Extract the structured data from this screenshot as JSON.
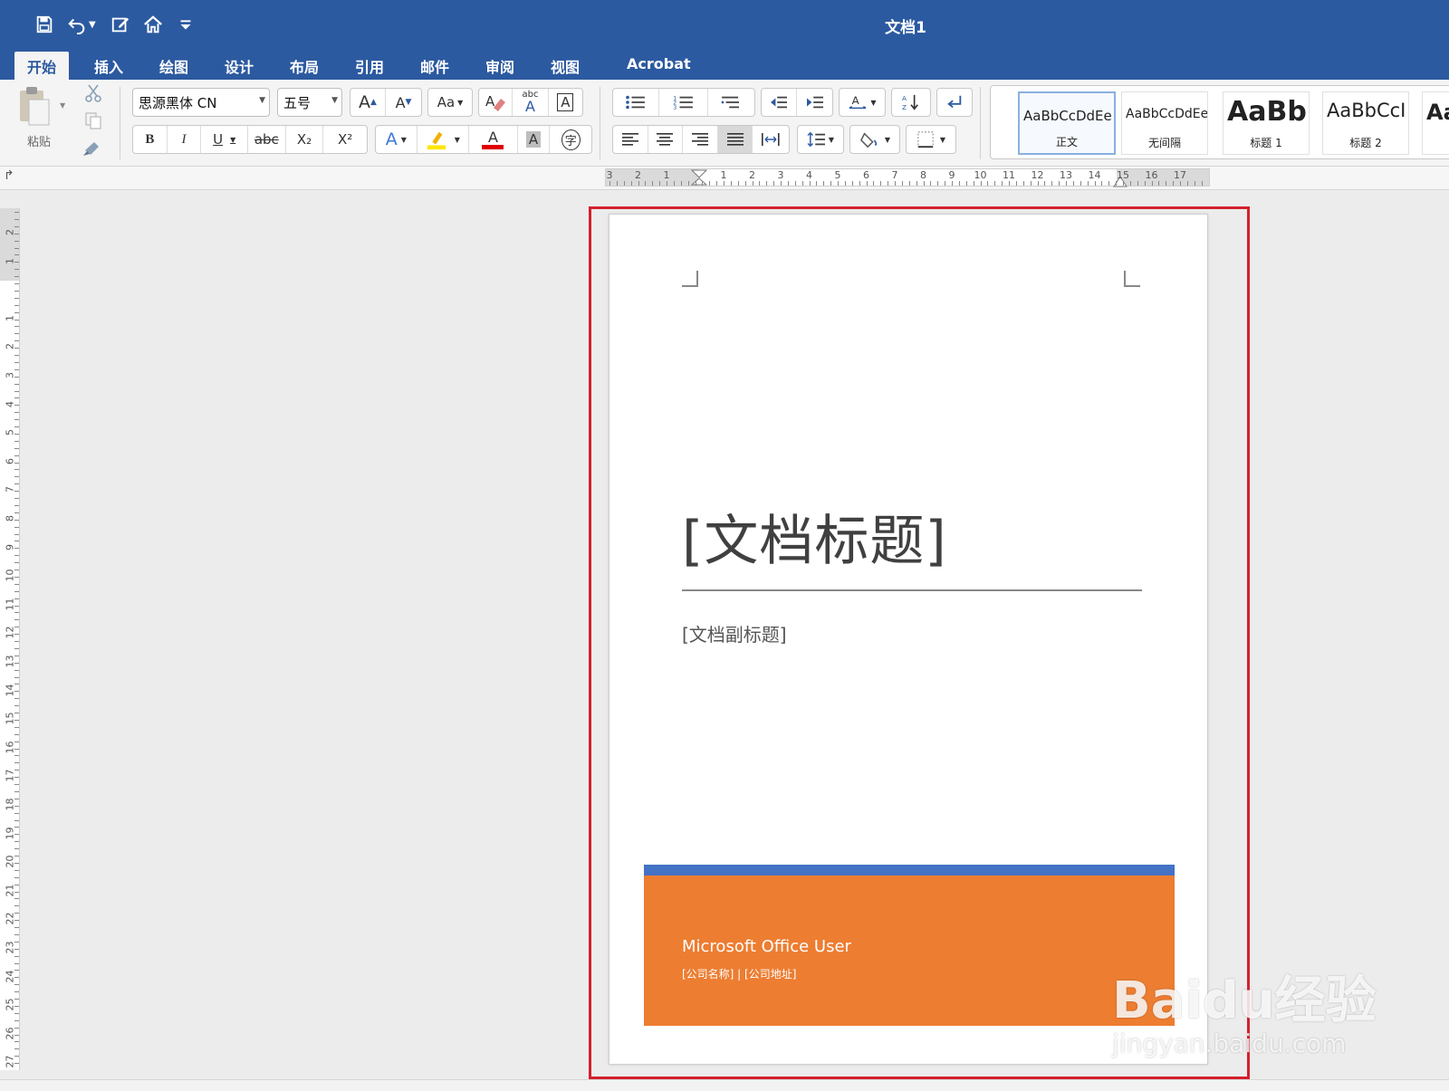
{
  "window": {
    "title": "文档1"
  },
  "tabs": [
    "开始",
    "插入",
    "绘图",
    "设计",
    "布局",
    "引用",
    "邮件",
    "审阅",
    "视图",
    "Acrobat"
  ],
  "clipboard": {
    "paste_label": "粘贴"
  },
  "font": {
    "name": "思源黑体 CN",
    "size": "五号"
  },
  "format_buttons": {
    "bold": "B",
    "italic": "I",
    "underline": "U",
    "strike": "abc",
    "subscript": "X₂",
    "superscript": "X²",
    "char_shade": "A",
    "enclose": "字",
    "grow": "A",
    "shrink": "A",
    "change_case": "Aa",
    "phonetic_top": "abc",
    "phonetic_bottom": "A",
    "char_border": "A",
    "effects": "A",
    "font_color": "A"
  },
  "styles": [
    {
      "preview": "AaBbCcDdEe",
      "name": "正文",
      "selected": true
    },
    {
      "preview": "AaBbCcDdEe",
      "name": "无间隔",
      "selected": false
    },
    {
      "preview": "AaBb(",
      "name": "标题 1",
      "selected": false
    },
    {
      "preview": "AaBbCcI",
      "name": "标题 2",
      "selected": false
    },
    {
      "preview": "Aa",
      "name": "",
      "selected": false
    }
  ],
  "ruler": {
    "horizontal_labels": [
      "3",
      "2",
      "1",
      "1",
      "2",
      "3",
      "4",
      "5",
      "6",
      "7",
      "8",
      "9",
      "10",
      "11",
      "12",
      "13",
      "14",
      "15",
      "16",
      "17"
    ],
    "vertical_labels": [
      "2",
      "1",
      "1",
      "2",
      "3",
      "4",
      "5",
      "6",
      "7",
      "8",
      "9",
      "10",
      "11",
      "12",
      "13",
      "14",
      "15",
      "16",
      "17",
      "18",
      "19",
      "20",
      "21",
      "22",
      "23",
      "24",
      "25",
      "26",
      "27"
    ]
  },
  "document": {
    "title_placeholder": "[文档标题]",
    "subtitle_placeholder": "[文档副标题]",
    "author": "Microsoft Office User",
    "company_line": "[公司名称] | [公司地址]"
  },
  "colors": {
    "title_bar": "#2c5aa0",
    "footer_band": "#4472c4",
    "footer_main": "#ed7d31",
    "highlight": "#d4202c"
  },
  "watermark": {
    "logo": "Baidu经验",
    "url": "jingyan.baidu.com"
  }
}
